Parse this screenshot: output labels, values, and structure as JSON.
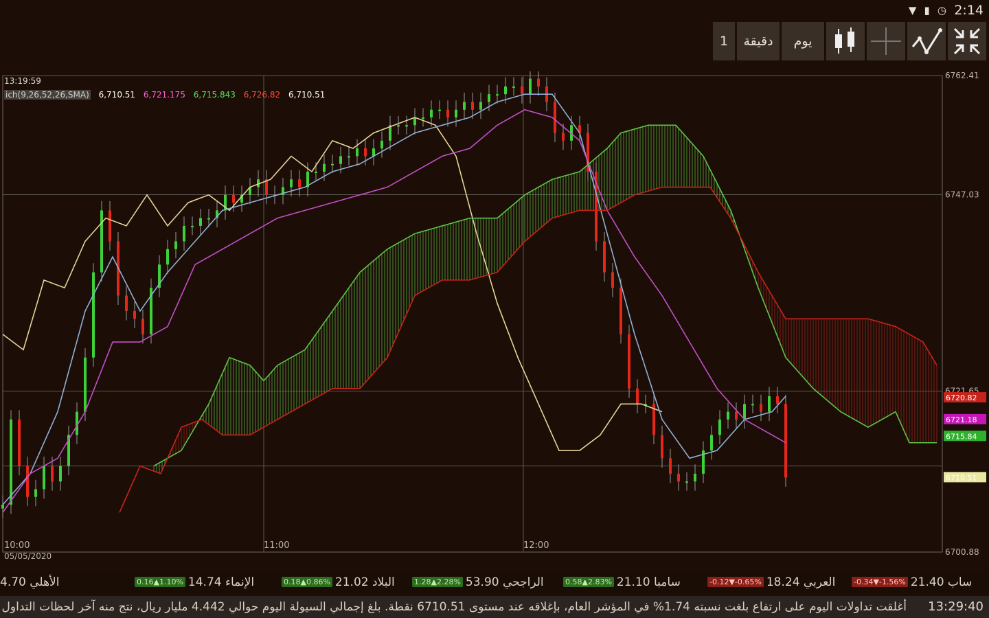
{
  "status": {
    "time": "2:14",
    "icons": [
      "wifi-icon",
      "battery-icon",
      "clock-icon"
    ]
  },
  "toolbar": {
    "period_value": "1",
    "minute_label": "دقيقة",
    "day_label": "يوم",
    "icons": [
      "candlestick-icon",
      "crosshair-icon",
      "line-chart-icon",
      "collapse-icon"
    ]
  },
  "chart_info": {
    "timestamp": "13:19:59",
    "indicator": "ich(9,26,52,26,SMA)",
    "values": [
      "6,710.51",
      "6,721.175",
      "6,715.843",
      "6,726.82",
      "6,710.51"
    ],
    "value_colors": [
      "#ffffff",
      "#ff5fd6",
      "#5de05d",
      "#ff4a3a",
      "#ffffff"
    ]
  },
  "chart_data": {
    "type": "candlestick",
    "title": "",
    "date": "05/05/2020",
    "x_tick_labels": [
      "10:00",
      "11:00",
      "12:00"
    ],
    "y_tick_labels": [
      "6762.41",
      "6747.03",
      "6721.65",
      "6700.88"
    ],
    "ylim": [
      6700.88,
      6762.41
    ],
    "grid": true,
    "price_labels": [
      {
        "value": "6720.82",
        "color": "#c8231a"
      },
      {
        "value": "6721.18",
        "color": "#c616b8"
      },
      {
        "value": "6715.84",
        "color": "#2fb12f"
      },
      {
        "value": "6710.51",
        "color": "#e8e8a0"
      }
    ],
    "series": [
      {
        "name": "price",
        "color": "#e8e8e8",
        "x": [
          0,
          12,
          24,
          36,
          48,
          60,
          72,
          84,
          96,
          108,
          120,
          132,
          144,
          156,
          168,
          180,
          192,
          204,
          216,
          228,
          240,
          252,
          264,
          276,
          288,
          300,
          312,
          324,
          336,
          348,
          360,
          372,
          384,
          396,
          408,
          420,
          432,
          444,
          456,
          468,
          480,
          492,
          504,
          516,
          528,
          540,
          552,
          564,
          576,
          588,
          600,
          612,
          624,
          636,
          648,
          660,
          672,
          684,
          696,
          708,
          720,
          732,
          744,
          756,
          768,
          780,
          792,
          804,
          816,
          828,
          840,
          852,
          864,
          876,
          888,
          900,
          912,
          924,
          936,
          948,
          960,
          972,
          984,
          996,
          1008,
          1020,
          1032,
          1044,
          1056,
          1068,
          1080,
          1092,
          1104,
          1116,
          1128,
          1140
        ],
        "y": [
          6707,
          6718,
          6712,
          6708,
          6709,
          6712,
          6710,
          6712,
          6716,
          6719,
          6726,
          6737,
          6745,
          6741,
          6734,
          6732,
          6731,
          6729,
          6735,
          6738,
          6740,
          6741,
          6743,
          6743,
          6744,
          6744,
          6745,
          6747,
          6746,
          6747,
          6748,
          6749,
          6747,
          6747,
          6748,
          6749,
          6748,
          6750,
          6750,
          6751,
          6751,
          6752,
          6752,
          6753,
          6752,
          6753,
          6754,
          6756,
          6756,
          6756,
          6757,
          6757,
          6758,
          6758,
          6757,
          6758,
          6759,
          6758,
          6759,
          6760,
          6760,
          6761,
          6761,
          6760,
          6762,
          6761,
          6759,
          6755,
          6754,
          6756,
          6755,
          6750,
          6741,
          6737,
          6735,
          6729,
          6722,
          6720,
          6720,
          6716,
          6713,
          6711,
          6710,
          6710,
          6711,
          6714,
          6716,
          6718,
          6719,
          6718,
          6720,
          6720,
          6719,
          6721,
          6720,
          6710.51
        ]
      },
      {
        "name": "chikou",
        "color": "#e6d39a",
        "x": [
          0,
          30,
          60,
          90,
          120,
          150,
          180,
          210,
          240,
          270,
          300,
          330,
          360,
          390,
          420,
          450,
          480,
          510,
          540,
          570,
          600,
          630,
          660,
          690,
          720,
          750,
          780,
          810,
          840,
          870,
          900,
          930,
          960
        ],
        "y": [
          6729,
          6727,
          6736,
          6735,
          6741,
          6744,
          6743,
          6747,
          6743,
          6746,
          6747,
          6745,
          6748,
          6749,
          6752,
          6750,
          6754,
          6753,
          6755,
          6756,
          6757,
          6756,
          6752,
          6742,
          6733,
          6726,
          6720,
          6714,
          6714,
          6716,
          6720,
          6720,
          6719
        ]
      },
      {
        "name": "tenkan",
        "color": "#8fb0d8",
        "x": [
          0,
          40,
          80,
          120,
          160,
          200,
          240,
          280,
          320,
          360,
          400,
          440,
          480,
          520,
          560,
          600,
          640,
          680,
          720,
          760,
          800,
          840,
          880,
          920,
          960,
          1000,
          1040,
          1080,
          1120,
          1140
        ],
        "y": [
          6707,
          6711,
          6719,
          6732,
          6739,
          6732,
          6737,
          6741,
          6745,
          6746,
          6747,
          6748,
          6750,
          6751,
          6753,
          6755,
          6756,
          6757,
          6759,
          6760,
          6760,
          6755,
          6742,
          6729,
          6718,
          6713,
          6714,
          6718,
          6719,
          6721
        ]
      },
      {
        "name": "kijun",
        "color": "#c34fc9",
        "x": [
          0,
          40,
          80,
          120,
          160,
          200,
          240,
          280,
          320,
          360,
          400,
          440,
          480,
          520,
          560,
          600,
          640,
          680,
          720,
          760,
          800,
          840,
          880,
          920,
          960,
          1000,
          1040,
          1080,
          1120,
          1140
        ],
        "y": [
          6706,
          6711,
          6713,
          6719,
          6728,
          6728,
          6730,
          6738,
          6740,
          6742,
          6744,
          6745,
          6746,
          6747,
          6748,
          6750,
          6752,
          6753,
          6756,
          6758,
          6757,
          6754,
          6745,
          6739,
          6734,
          6728,
          6722,
          6718,
          6716,
          6715
        ]
      },
      {
        "name": "senkou_a",
        "color": "#5cc44a",
        "x": [
          220,
          260,
          300,
          330,
          360,
          380,
          400,
          440,
          480,
          520,
          560,
          600,
          640,
          680,
          720,
          760,
          800,
          840,
          880,
          900,
          940,
          980,
          1020,
          1060,
          1100,
          1140,
          1180,
          1220,
          1260,
          1300,
          1320,
          1360
        ],
        "y": [
          6712,
          6714,
          6720,
          6726,
          6725,
          6723,
          6725,
          6727,
          6732,
          6737,
          6740,
          6742,
          6743,
          6744,
          6744,
          6747,
          6749,
          6750,
          6753,
          6755,
          6756,
          6756,
          6752,
          6745,
          6735,
          6726,
          6722,
          6719,
          6717,
          6719,
          6715,
          6715
        ]
      },
      {
        "name": "senkou_b",
        "color": "#c8231a",
        "x": [
          170,
          200,
          230,
          260,
          290,
          320,
          360,
          400,
          440,
          480,
          520,
          560,
          600,
          640,
          680,
          720,
          760,
          800,
          840,
          880,
          920,
          960,
          1000,
          1030,
          1060,
          1100,
          1140,
          1200,
          1260,
          1300,
          1340,
          1360
        ],
        "y": [
          6706,
          6712,
          6711,
          6717,
          6718,
          6716,
          6716,
          6718,
          6720,
          6722,
          6722,
          6726,
          6734,
          6736,
          6736,
          6737,
          6741,
          6744,
          6745,
          6745,
          6747,
          6748,
          6748,
          6748,
          6744,
          6737,
          6731,
          6731,
          6731,
          6730,
          6728,
          6725
        ]
      }
    ]
  },
  "ticker": [
    {
      "name": "ساب",
      "price": "21.40",
      "change": "-0.34",
      "pct": "-1.56%",
      "dir": "down"
    },
    {
      "name": "العربي",
      "price": "18.24",
      "change": "-0.12",
      "pct": "-0.65%",
      "dir": "down"
    },
    {
      "name": "سامبا",
      "price": "21.10",
      "change": "0.58",
      "pct": "2.83%",
      "dir": "up"
    },
    {
      "name": "الراجحي",
      "price": "53.90",
      "change": "1.28",
      "pct": "2.28%",
      "dir": "up"
    },
    {
      "name": "البلاد",
      "price": "21.02",
      "change": "0.18",
      "pct": "0.86%",
      "dir": "up"
    },
    {
      "name": "الإنماء",
      "price": "14.74",
      "change": "0.16",
      "pct": "1.10%",
      "dir": "up"
    },
    {
      "name": "الأهلي",
      "price": "4.70",
      "change": "",
      "pct": "",
      "dir": ""
    }
  ],
  "news": {
    "time": "13:29:40",
    "text": "أغلقت تداولات اليوم على ارتفاع بلغت نسبته 1.74% في المؤشر العام، بإغلاقه عند مستوى 6710.51 نقطة. بلغ إجمالي السيولة اليوم حوالي 4.442 مليار ريال، نتج منه آخر لحظات التداول صا..."
  }
}
